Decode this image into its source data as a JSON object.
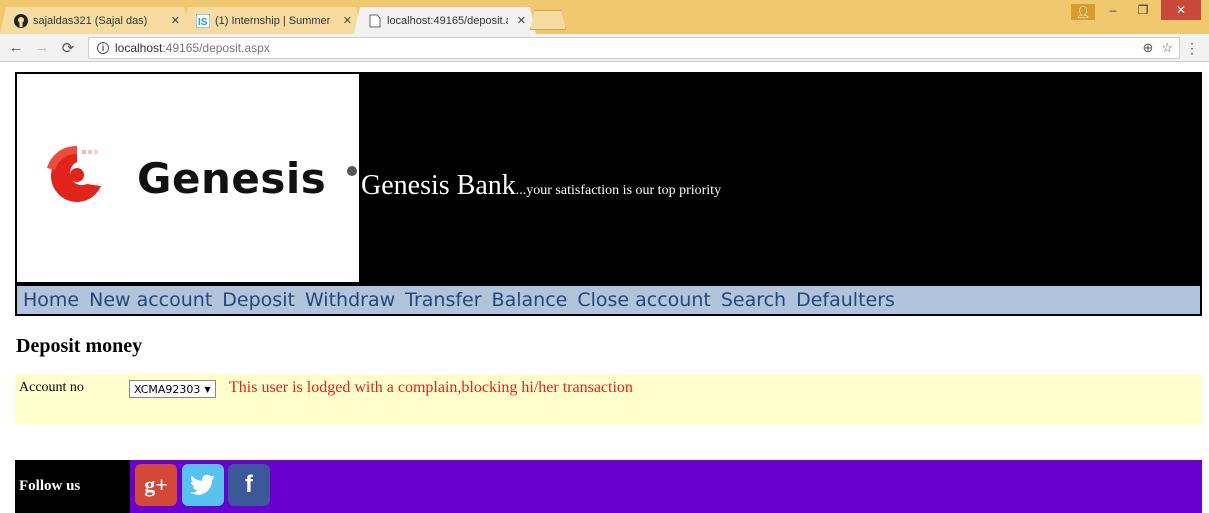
{
  "browser": {
    "tabs": [
      {
        "title": "sajaldas321 (Sajal das)",
        "icon": "github-icon"
      },
      {
        "title": "(1) Internship | Summer I",
        "icon": "internshala-icon"
      },
      {
        "title": "localhost:49165/deposit.a",
        "icon": "document-icon"
      }
    ],
    "url_host": "localhost",
    "url_rest": ":49165/deposit.aspx"
  },
  "header": {
    "logo_text": "Genesis",
    "bank_name": "Genesis Bank",
    "tagline": "...your satisfaction is our top priority"
  },
  "nav": {
    "items": [
      "Home",
      "New account",
      "Deposit",
      "Withdraw",
      "Transfer",
      "Balance",
      "Close account",
      "Search",
      "Defaulters"
    ]
  },
  "page": {
    "heading": "Deposit money",
    "account_label": "Account no",
    "account_value": "XCMA92303",
    "error": "This user is lodged with a complain,blocking hi/her transaction"
  },
  "footer": {
    "follow_label": "Follow us",
    "gplus_glyph": "g+",
    "facebook_glyph": "f"
  },
  "colors": {
    "nav_bg": "#b0c4de",
    "nav_text": "#284775",
    "panel_bg": "#ffffcc",
    "error": "#e32222",
    "footer_bg": "#6a00d0"
  }
}
